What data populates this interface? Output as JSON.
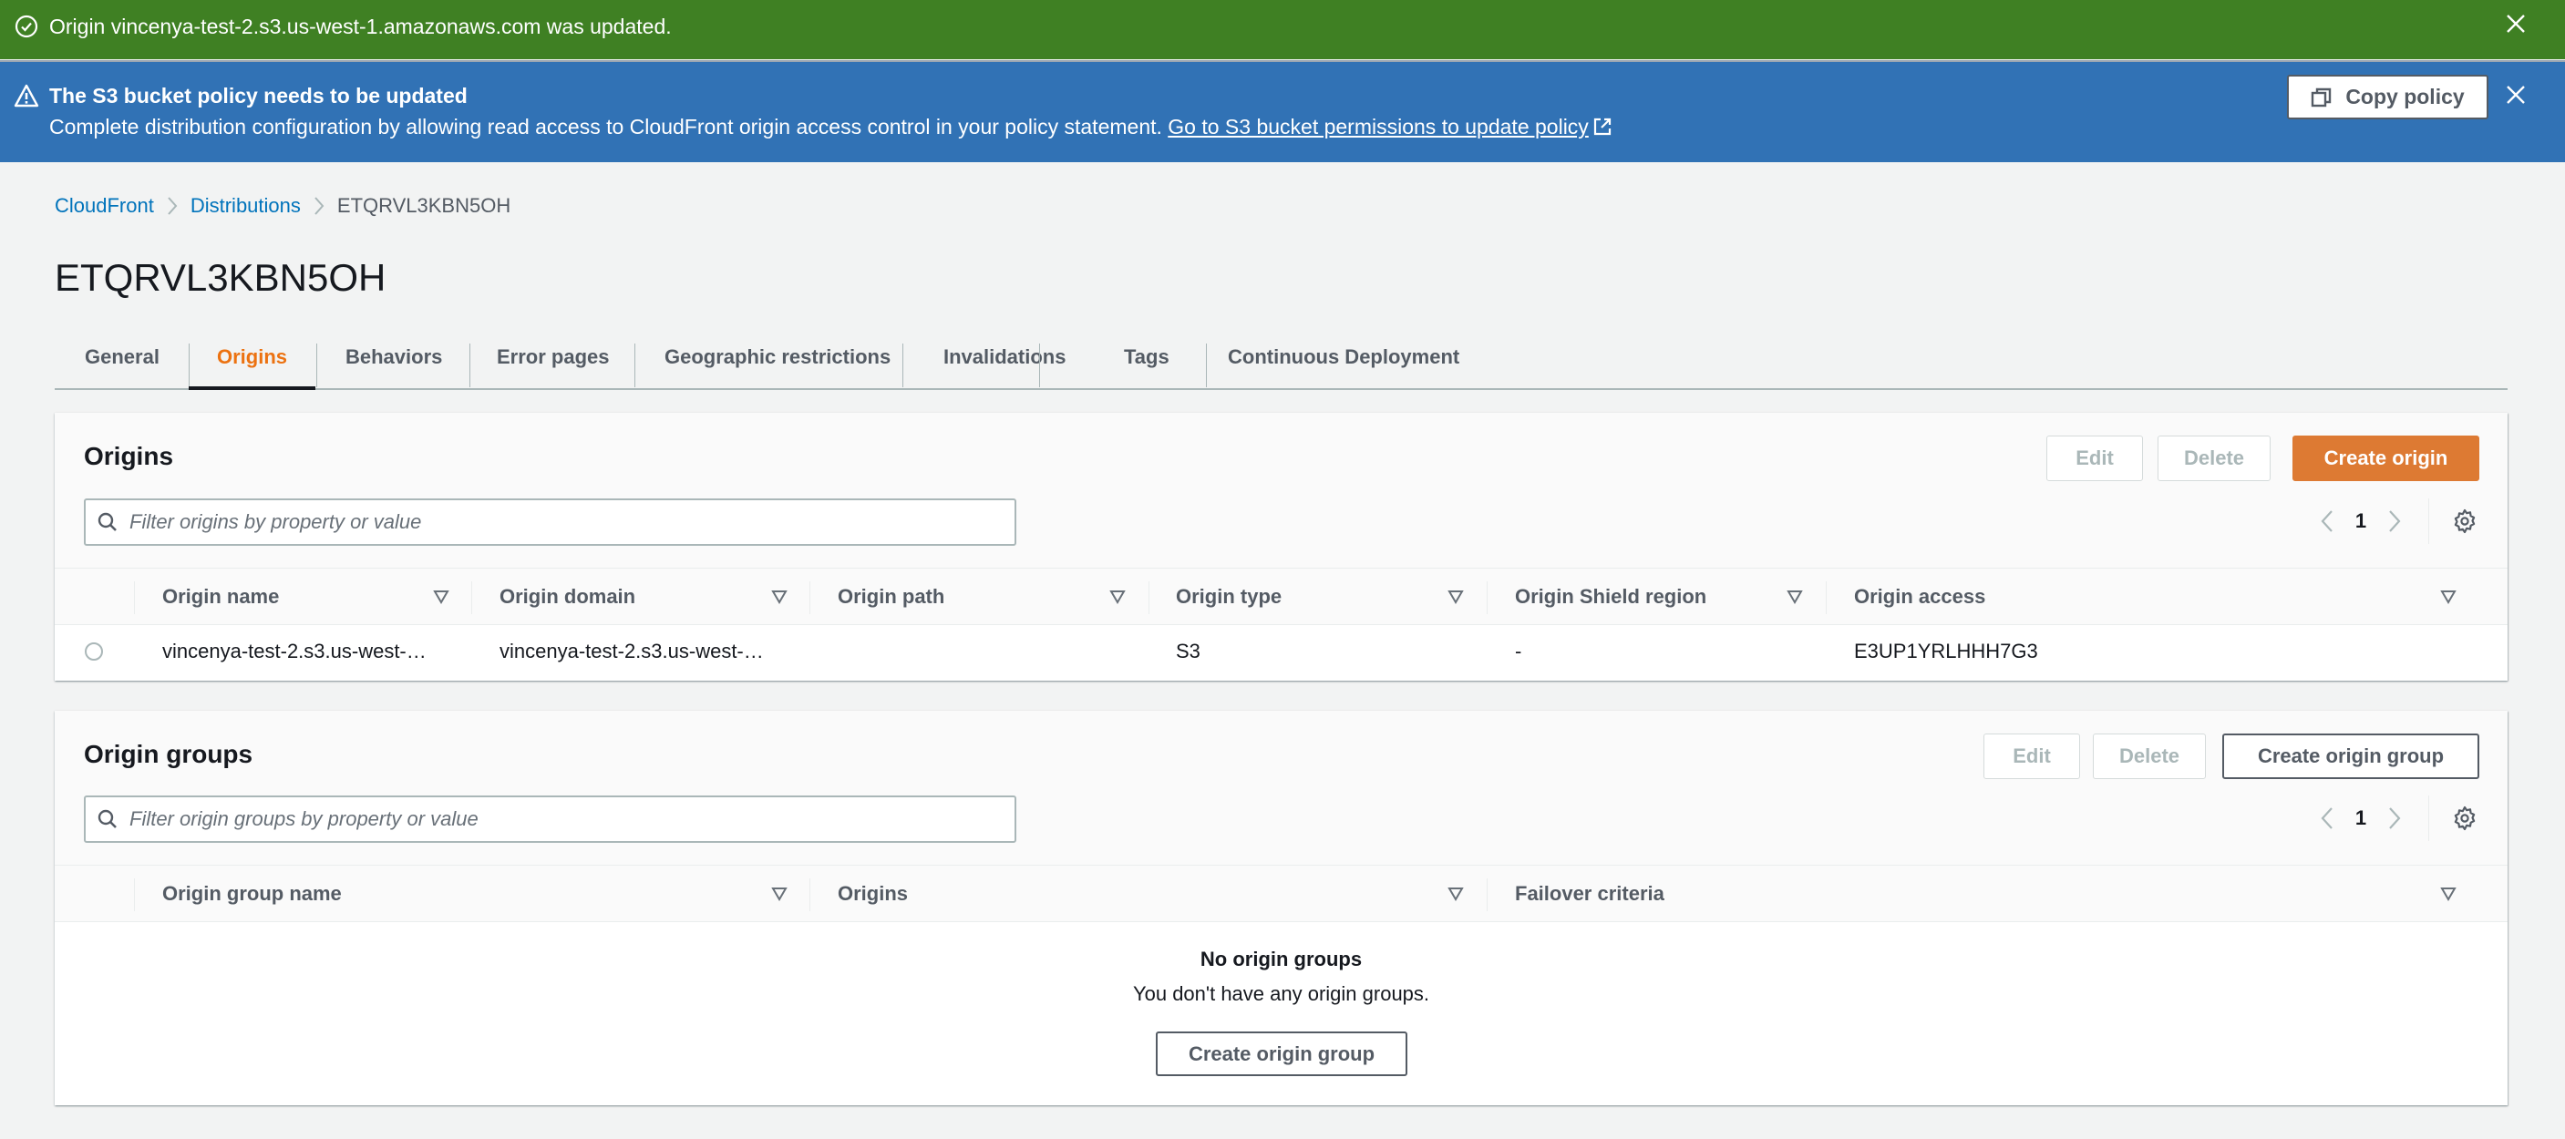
{
  "flash_success": {
    "icon": "check-circle-icon",
    "message": "Origin vincenya-test-2.s3.us-west-1.amazonaws.com was updated.",
    "color": "#3f8023"
  },
  "flash_info": {
    "icon": "warning-icon",
    "header": "The S3 bucket policy needs to be updated",
    "body": "Complete distribution configuration by allowing read access to CloudFront origin access control in your policy statement.",
    "link": "Go to S3 bucket permissions to update policy",
    "copy_button": "Copy policy",
    "color": "#3172b5"
  },
  "breadcrumb": {
    "items": [
      "CloudFront",
      "Distributions"
    ],
    "current": "ETQRVL3KBN5OH"
  },
  "page_title": "ETQRVL3KBN5OH",
  "tabs": [
    {
      "label": "General",
      "active": false
    },
    {
      "label": "Origins",
      "active": true
    },
    {
      "label": "Behaviors",
      "active": false
    },
    {
      "label": "Error pages",
      "active": false
    },
    {
      "label": "Geographic restrictions",
      "active": false
    },
    {
      "label": "Invalidations",
      "active": false
    },
    {
      "label": "Tags",
      "active": false
    },
    {
      "label": "Continuous Deployment",
      "active": false
    }
  ],
  "origins": {
    "title": "Origins",
    "edit": "Edit",
    "delete": "Delete",
    "create": "Create origin",
    "filter_placeholder": "Filter origins by property or value",
    "page": "1",
    "columns": [
      "Origin name",
      "Origin domain",
      "Origin path",
      "Origin type",
      "Origin Shield region",
      "Origin access"
    ],
    "rows": [
      {
        "name": "vincenya-test-2.s3.us-west-…",
        "domain": "vincenya-test-2.s3.us-west-…",
        "path": "",
        "type": "S3",
        "shield": "-",
        "access": "E3UP1YRLHHH7G3"
      }
    ]
  },
  "origin_groups": {
    "title": "Origin groups",
    "edit": "Edit",
    "delete": "Delete",
    "create": "Create origin group",
    "filter_placeholder": "Filter origin groups by property or value",
    "page": "1",
    "columns": [
      "Origin group name",
      "Origins",
      "Failover criteria"
    ],
    "empty_title": "No origin groups",
    "empty_body": "You don't have any origin groups.",
    "empty_button": "Create origin group"
  },
  "colors": {
    "primary": "#ec7211",
    "primary_button": "#dd7a33",
    "link": "#0073bb"
  }
}
